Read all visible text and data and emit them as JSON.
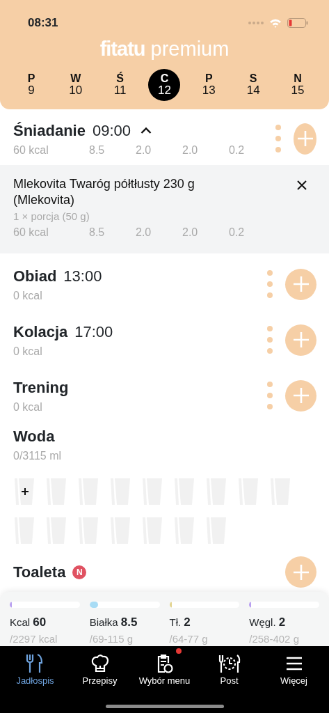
{
  "status_bar": {
    "time": "08:31"
  },
  "header": {
    "logo_bold": "fitatu",
    "logo_light": "premium"
  },
  "days": [
    {
      "letter": "P",
      "date": "9",
      "selected": false
    },
    {
      "letter": "W",
      "date": "10",
      "selected": false
    },
    {
      "letter": "Ś",
      "date": "11",
      "selected": false
    },
    {
      "letter": "C",
      "date": "12",
      "selected": true
    },
    {
      "letter": "P",
      "date": "13",
      "selected": false
    },
    {
      "letter": "S",
      "date": "14",
      "selected": false
    },
    {
      "letter": "N",
      "date": "15",
      "selected": false
    }
  ],
  "meals": [
    {
      "name": "Śniadanie",
      "time": "09:00",
      "expanded": true,
      "kcal": "60 kcal",
      "macros": [
        "8.5",
        "2.0",
        "2.0",
        "0.2"
      ],
      "items": [
        {
          "name": "Mlekovita Twaróg półtłusty 230 g (Mlekovita)",
          "portion": "1 × porcja (50 g)",
          "kcal": "60 kcal",
          "macros": [
            "8.5",
            "2.0",
            "2.0",
            "0.2"
          ]
        }
      ]
    },
    {
      "name": "Obiad",
      "time": "13:00",
      "kcal": "0 kcal"
    },
    {
      "name": "Kolacja",
      "time": "17:00",
      "kcal": "0 kcal"
    },
    {
      "name": "Trening",
      "kcal": "0 kcal"
    }
  ],
  "water": {
    "title": "Woda",
    "amount": "0/3115 ml",
    "glasses": [
      {
        "kind": "add"
      },
      {
        "kind": "empty"
      },
      {
        "kind": "empty"
      },
      {
        "kind": "empty"
      },
      {
        "kind": "empty"
      },
      {
        "kind": "empty"
      },
      {
        "kind": "empty"
      },
      {
        "kind": "empty"
      },
      {
        "kind": "empty"
      },
      {
        "kind": "empty"
      },
      {
        "kind": "empty"
      },
      {
        "kind": "empty"
      },
      {
        "kind": "empty"
      },
      {
        "kind": "empty"
      },
      {
        "kind": "empty"
      },
      {
        "kind": "empty"
      }
    ]
  },
  "toilet": {
    "title": "Toaleta",
    "badge": "N"
  },
  "summary": [
    {
      "label": "Kcal",
      "value": "60",
      "target": "/2297 kcal",
      "level": 0.026,
      "color": "#b9a0f0"
    },
    {
      "label": "Białka",
      "value": "8.5",
      "target": "/69-115 g",
      "level": 0.12,
      "color": "#a8dcf5"
    },
    {
      "label": "Tł.",
      "value": "2",
      "target": "/64-77 g",
      "level": 0.03,
      "color": "#e2d38f"
    },
    {
      "label": "Węgl.",
      "value": "2",
      "target": "/258-402 g",
      "level": 0.01,
      "color": "#b9a0f0"
    }
  ],
  "nav": [
    {
      "label": "Jadłospis",
      "kind": "cutlery",
      "selected": true,
      "dot": false
    },
    {
      "label": "Przepisy",
      "kind": "chef",
      "selected": false,
      "dot": false
    },
    {
      "label": "Wybór menu",
      "kind": "clipboard",
      "selected": false,
      "dot": true
    },
    {
      "label": "Post",
      "kind": "fast",
      "selected": false,
      "dot": false
    },
    {
      "label": "Więcej",
      "kind": "menu",
      "selected": false,
      "dot": false
    }
  ]
}
